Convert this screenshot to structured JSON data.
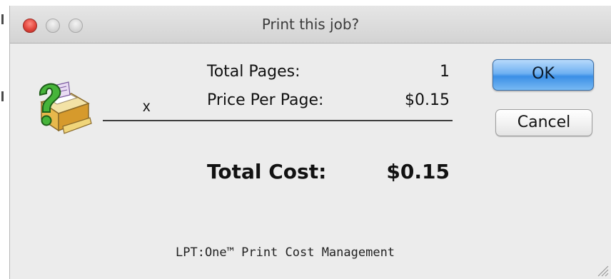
{
  "window": {
    "title": "Print this job?"
  },
  "icons": {
    "app": "printer-question-icon",
    "resize": "resize-grip-icon"
  },
  "job": {
    "multiply_symbol": "x",
    "total_pages_label": "Total Pages:",
    "total_pages_value": "1",
    "price_per_page_label": "Price Per Page:",
    "price_per_page_value": "$0.15",
    "total_cost_label": "Total Cost:",
    "total_cost_value": "$0.15"
  },
  "buttons": {
    "ok_label": "OK",
    "cancel_label": "Cancel"
  },
  "footer": {
    "text": "LPT:One™ Print Cost Management"
  },
  "colors": {
    "ok_accent": "#3b8fe6",
    "close_button": "#e2463c",
    "window_bg": "#ececec"
  }
}
